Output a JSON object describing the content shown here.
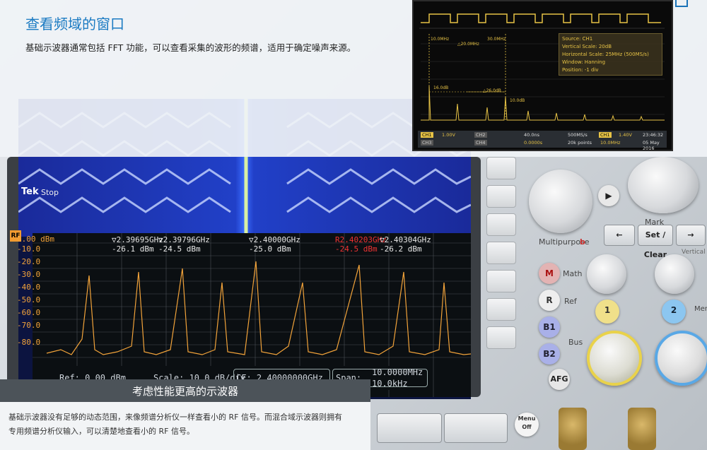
{
  "header": {
    "title": "查看频域的窗口",
    "description": "基础示波器通常包括 FFT 功能，可以查看采集的波形的频谱，适用于确定噪声来源。"
  },
  "main_screen": {
    "brand": "Tek",
    "state": "Stop",
    "y_ticks": [
      "0.00 dBm",
      "-10.0",
      "-20.0",
      "-30.0",
      "-40.0",
      "-50.0",
      "-60.0",
      "-70.0",
      "-80.0"
    ],
    "markers": [
      {
        "freq": "2.39695GHz",
        "level": "-26.1 dBm"
      },
      {
        "freq": "2.39796GHz",
        "level": "-24.5 dBm"
      },
      {
        "freq": "2.40000GHz",
        "level": "-25.0 dBm"
      },
      {
        "freq": "2.40203GHz",
        "level": "-24.5 dBm",
        "reference": true
      },
      {
        "freq": "2.40304GHz",
        "level": "-26.2 dBm"
      }
    ],
    "ref_label": "Ref: 0.00 dBm",
    "scale_label": "Scale: 10.0 dB/div",
    "cf_label": "CF: 2.40000000GHz",
    "span_label": "Span:",
    "span_value": "10.0000MHz",
    "rbw_value": "10.0kHz"
  },
  "controls": {
    "multipurpose": "Multipurpose",
    "multipurpose_b": "b",
    "mark": "Mark",
    "set_clear": "Set / Clear",
    "math": "Math",
    "ref": "Ref",
    "bus": "Bus",
    "afg": "AFG",
    "menu_off": "Menu Off",
    "ch1": "1",
    "ch2": "2",
    "m": "M",
    "r": "R",
    "b1": "B1",
    "b2": "B2",
    "menu": "Menu",
    "vertical": "Vertical"
  },
  "inset": {
    "source": "Source: CH1",
    "vertical_scale": "Vertical Scale: 20dB",
    "horizontal_scale": "Horizontal Scale: 25MHz (500MS/s)",
    "window": "Window: Hanning",
    "position": "Position: -1 div",
    "cursor_a": "10.0MHz",
    "cursor_b": "30.0MHz",
    "delta_freq": "△20.0MHz",
    "peak1": "16.0dB",
    "delta_db": "△26.0dB",
    "peak2": "10.0dB",
    "status": {
      "ch1": "CH1",
      "ch1_val": "1.00V",
      "ch2": "CH2",
      "ch3": "CH3",
      "ch4": "CH4",
      "timebase": "40.0ns",
      "delay": "0.0000s",
      "rate": "500MS/s",
      "points": "20k points",
      "trig_ch": "CH1",
      "trig_level": "1.40V",
      "trig_freq": "10.0MHz",
      "time": "23:46:32",
      "date": "05 May 2016"
    }
  },
  "bottom": {
    "title": "考虑性能更高的示波器",
    "line1": "基础示波器没有足够的动态范围，来像频谱分析仪一样查看小的 RF 信号。而混合域示波器则拥有",
    "line2": "专用频谱分析仪输入，可以清楚地查看小的 RF 信号。"
  },
  "colors": {
    "title_blue": "#1a7ac2",
    "trace_orange": "#f2a33a",
    "inset_yellow": "#e6c245",
    "marker_red": "#e33333"
  }
}
